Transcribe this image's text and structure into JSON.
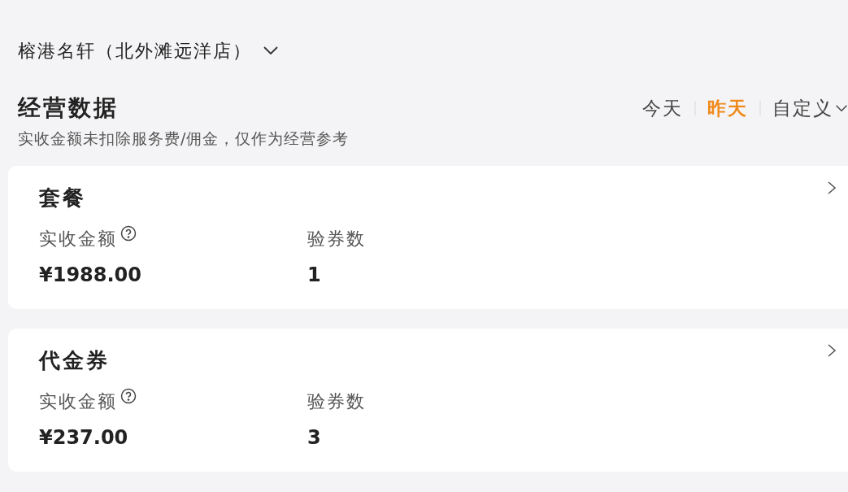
{
  "store": {
    "name": "榕港名轩（北外滩远洋店）"
  },
  "section": {
    "title": "经营数据",
    "note": "实收金额未扣除服务费/佣金，仅作为经营参考"
  },
  "periods": [
    {
      "label": "今天",
      "selected": false,
      "dropdown": false
    },
    {
      "label": "昨天",
      "selected": true,
      "dropdown": false
    },
    {
      "label": "自定义",
      "selected": false,
      "dropdown": true
    }
  ],
  "cards": [
    {
      "title": "套餐",
      "metrics": [
        {
          "label": "实收金额",
          "help": true,
          "value": "¥1988.00"
        },
        {
          "label": "验券数",
          "help": false,
          "value": "1"
        }
      ]
    },
    {
      "title": "代金券",
      "metrics": [
        {
          "label": "实收金额",
          "help": true,
          "value": "¥237.00"
        },
        {
          "label": "验券数",
          "help": false,
          "value": "3"
        }
      ]
    }
  ]
}
